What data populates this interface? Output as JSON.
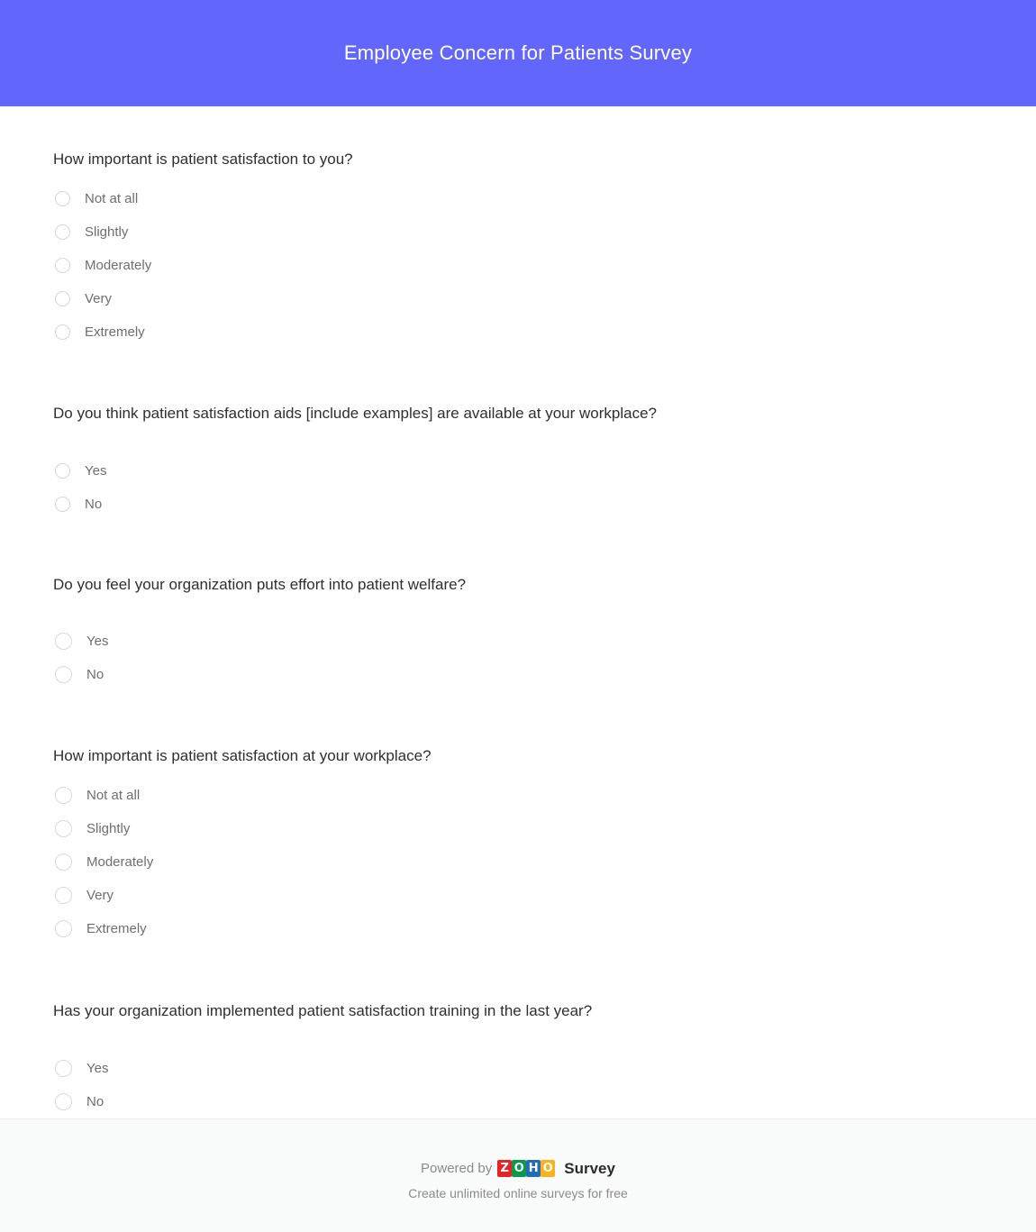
{
  "header": {
    "title": "Employee Concern for Patients Survey",
    "background_color": "#6266fb",
    "title_color": "#ffffff"
  },
  "survey": {
    "questions": [
      {
        "id": "q1",
        "title": "How important is patient satisfaction to you?",
        "type": "radio",
        "options": [
          {
            "label": "Not at all",
            "selected": false
          },
          {
            "label": "Slightly",
            "selected": false
          },
          {
            "label": "Moderately",
            "selected": false
          },
          {
            "label": "Very",
            "selected": false
          },
          {
            "label": "Extremely",
            "selected": false
          }
        ]
      },
      {
        "id": "q2",
        "title": "Do you think patient satisfaction aids [include examples] are available at your workplace?",
        "type": "radio",
        "options": [
          {
            "label": "Yes",
            "selected": false
          },
          {
            "label": "No",
            "selected": false
          }
        ]
      },
      {
        "id": "q3",
        "title": "Do you feel your organization puts effort into patient welfare?",
        "type": "radio",
        "options": [
          {
            "label": "Yes",
            "selected": false
          },
          {
            "label": "No",
            "selected": false
          }
        ]
      },
      {
        "id": "q4",
        "title": "How important is patient satisfaction at your workplace?",
        "type": "radio",
        "options": [
          {
            "label": "Not at all",
            "selected": false
          },
          {
            "label": "Slightly",
            "selected": false
          },
          {
            "label": "Moderately",
            "selected": false
          },
          {
            "label": "Very",
            "selected": false
          },
          {
            "label": "Extremely",
            "selected": false
          }
        ]
      },
      {
        "id": "q5",
        "title": "Has your organization implemented patient satisfaction training in the last year?",
        "type": "radio",
        "options": [
          {
            "label": "Yes",
            "selected": false
          },
          {
            "label": "No",
            "selected": false
          }
        ]
      }
    ]
  },
  "footer": {
    "powered_by": "Powered by",
    "brand_letters": [
      "Z",
      "O",
      "H",
      "O"
    ],
    "brand_colors": [
      "#e42527",
      "#089949",
      "#226db4",
      "#f9b21d"
    ],
    "product": "Survey",
    "tagline": "Create unlimited online surveys for free"
  }
}
